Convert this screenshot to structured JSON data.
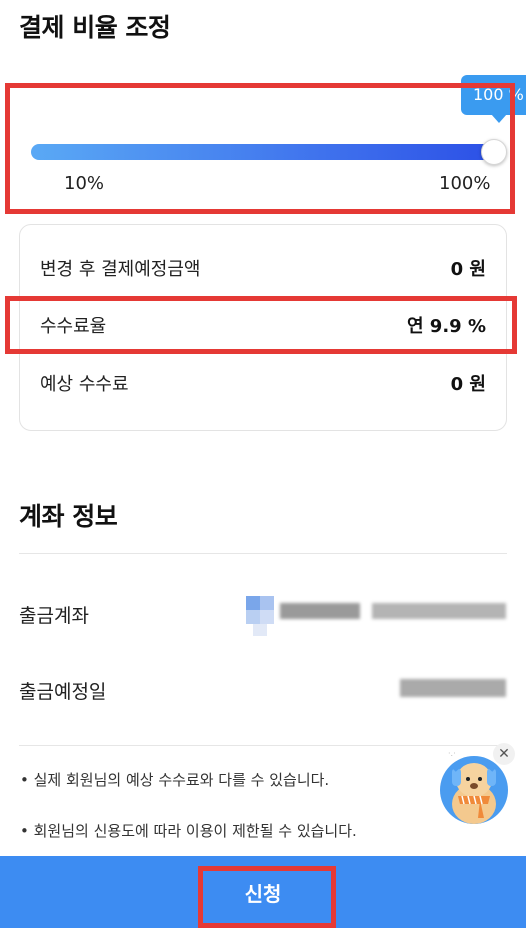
{
  "payment_ratio": {
    "title": "결제 비율 조정",
    "slider": {
      "tooltip": "100 %",
      "min_label": "10%",
      "max_label": "100%",
      "value_percent": 100
    }
  },
  "summary": {
    "rows": [
      {
        "label": "변경 후 결제예정금액",
        "value": "0 원"
      },
      {
        "label": "수수료율",
        "value": "연 9.9 %"
      },
      {
        "label": "예상 수수료",
        "value": "0 원"
      }
    ]
  },
  "account_info": {
    "title": "계좌 정보",
    "withdraw_account_label": "출금계좌",
    "withdraw_date_label": "출금예정일"
  },
  "notices": [
    "실제 회원님의 예상 수수료와 다를 수 있습니다.",
    "회원님의 신용도에 따라 이용이 제한될 수 있습니다."
  ],
  "apply_button": "신청",
  "colors": {
    "accent": "#3d8cf2",
    "highlight": "#e53935",
    "tooltip": "#3a9bf0"
  },
  "icons": {
    "mascot": "bear-mascot-icon",
    "close": "close-icon"
  }
}
